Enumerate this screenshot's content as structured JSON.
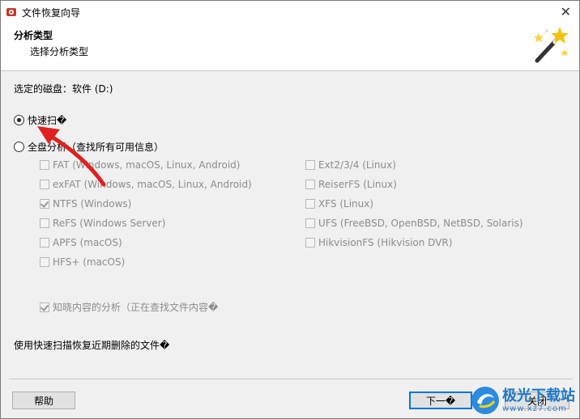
{
  "window": {
    "title": "文件恢复向导",
    "close_glyph": "✕"
  },
  "header": {
    "title": "分析类型",
    "subtitle": "选择分析类型"
  },
  "disk_label": "选定的磁盘：软件 (D:)",
  "radios": {
    "quick": "快速扫�",
    "full": "全盘分析（查找所有可用信息）"
  },
  "fs_left": [
    {
      "label": "FAT (Windows, macOS, Linux, Android)",
      "checked": false
    },
    {
      "label": "exFAT (Windows, macOS, Linux, Android)",
      "checked": false
    },
    {
      "label": "NTFS (Windows)",
      "checked": true
    },
    {
      "label": "ReFS (Windows Server)",
      "checked": false
    },
    {
      "label": "APFS (macOS)",
      "checked": false
    },
    {
      "label": "HFS+ (macOS)",
      "checked": false
    }
  ],
  "fs_right": [
    {
      "label": "Ext2/3/4 (Linux)",
      "checked": false
    },
    {
      "label": "ReiserFS (Linux)",
      "checked": false
    },
    {
      "label": "XFS (Linux)",
      "checked": false
    },
    {
      "label": "UFS (FreeBSD, OpenBSD, NetBSD, Solaris)",
      "checked": false
    },
    {
      "label": "HikvisionFS (Hikvision DVR)",
      "checked": false
    }
  ],
  "content_analysis": "知晓内容的分析（正在查找文件内容�",
  "hint": "使用快速扫描恢复近期删除的文件�",
  "buttons": {
    "help": "帮助",
    "next": "下一�",
    "close": "关闭"
  },
  "watermark": {
    "name": "极光下载站",
    "url": "www.xz7.com"
  },
  "colors": {
    "arrow": "#e02020",
    "watermark_blue": "#1f78c8"
  }
}
